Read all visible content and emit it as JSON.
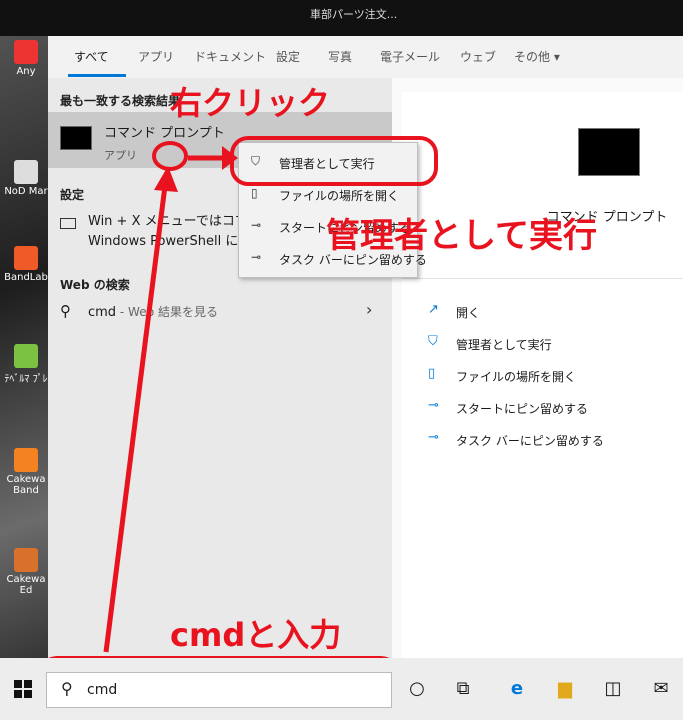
{
  "window": {
    "title": "車部パーツ注文..."
  },
  "desktop_icons": [
    "Any",
    "NoD Mar",
    "BandLab",
    "ﾃﾍﾞﾙﾏ ﾌﾟﾚ",
    "Cakewa Band",
    "Cakewa Ed"
  ],
  "tabs": [
    "すべて",
    "アプリ",
    "ドキュメント",
    "設定",
    "写真",
    "電子メール",
    "ウェブ",
    "その他 ▾"
  ],
  "best_match": {
    "heading": "最も一致する検索結果",
    "name": "コマンド プロンプト",
    "type": "アプリ"
  },
  "settings": {
    "heading": "設定",
    "item": "Win + X メニューではコマンド プロンプトを Windows PowerShell に置き換える"
  },
  "web": {
    "heading": "Web の検索",
    "query": "cmd",
    "sub": " - Web 結果を見る"
  },
  "detail": {
    "name": "コマンド プロンプト",
    "actions": [
      "開く",
      "管理者として実行",
      "ファイルの場所を開く",
      "スタートにピン留めする",
      "タスク バーにピン留めする"
    ]
  },
  "context_menu": [
    "管理者として実行",
    "ファイルの場所を開く",
    "スタートにピン留めする",
    "タスク バーにピン留めする"
  ],
  "annotations": {
    "right_click": "右クリック",
    "run_as_admin": "管理者として実行",
    "type_cmd": "cmdと入力"
  },
  "taskbar": {
    "search_value": "cmd"
  },
  "colors": {
    "accent": "#0078d7",
    "annotation": "#e8131f"
  }
}
